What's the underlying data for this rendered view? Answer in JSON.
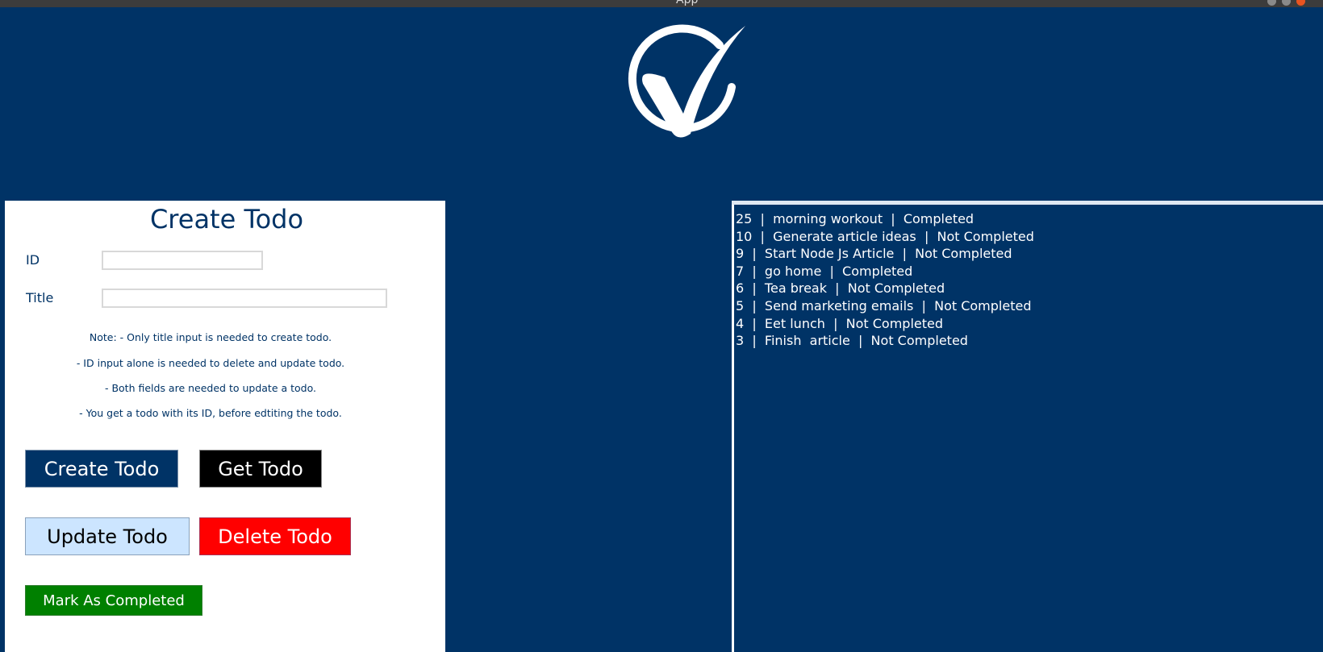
{
  "window": {
    "title": "App"
  },
  "form": {
    "title": "Create Todo",
    "id_label": "ID",
    "title_label": "Title",
    "id_value": "",
    "title_value": "",
    "notes": [
      "Note: - Only title input is needed to create todo.",
      "- ID input alone is needed to delete and update todo.",
      "- Both fields are needed to update a todo.",
      "- You get a todo with its ID, before edtiting the todo."
    ]
  },
  "buttons": {
    "create": "Create Todo",
    "get": "Get Todo",
    "update": "Update Todo",
    "delete": "Delete Todo",
    "mark_completed": "Mark As Completed"
  },
  "todos": [
    {
      "id": "25",
      "title": "morning workout",
      "status": "Completed"
    },
    {
      "id": "10",
      "title": "Generate article ideas",
      "status": "Not Completed"
    },
    {
      "id": "9",
      "title": "Start Node Js Article",
      "status": "Not Completed"
    },
    {
      "id": "7",
      "title": "go home",
      "status": "Completed"
    },
    {
      "id": "6",
      "title": "Tea break",
      "status": "Not Completed"
    },
    {
      "id": "5",
      "title": "Send marketing emails",
      "status": "Not Completed"
    },
    {
      "id": "4",
      "title": "Eet lunch",
      "status": "Not Completed"
    },
    {
      "id": "3",
      "title": "Finish  article",
      "status": "Not Completed"
    }
  ],
  "colors": {
    "background": "#003366",
    "create_button": "#003366",
    "get_button": "#000000",
    "update_button": "#cce5ff",
    "delete_button": "#ff0000",
    "complete_button": "#008000"
  },
  "icons": {
    "logo": "checkmark-circle-icon"
  }
}
